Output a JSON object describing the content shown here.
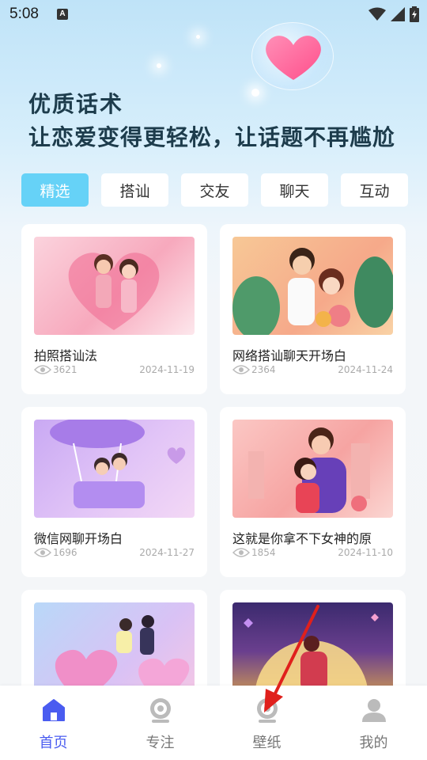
{
  "status": {
    "time": "5:08",
    "a_icon": "A"
  },
  "hero": {
    "line1": "优质话术",
    "line2": "让恋爱变得更轻松，让话题不再尴尬"
  },
  "tabs": [
    {
      "label": "精选",
      "active": true
    },
    {
      "label": "搭讪",
      "active": false
    },
    {
      "label": "交友",
      "active": false
    },
    {
      "label": "聊天",
      "active": false
    },
    {
      "label": "互动",
      "active": false
    }
  ],
  "cards": [
    {
      "title": "拍照搭讪法",
      "views": "3621",
      "date": "2024-11-19"
    },
    {
      "title": "网络搭讪聊天开场白",
      "views": "2364",
      "date": "2024-11-24"
    },
    {
      "title": "微信网聊开场白",
      "views": "1696",
      "date": "2024-11-27"
    },
    {
      "title": "这就是你拿不下女神的原",
      "views": "1854",
      "date": "2024-11-10"
    },
    {
      "title": "",
      "views": "",
      "date": ""
    },
    {
      "title": "",
      "views": "",
      "date": ""
    }
  ],
  "nav": [
    {
      "label": "首页",
      "icon": "home-icon",
      "active": true
    },
    {
      "label": "专注",
      "icon": "focus-icon",
      "active": false
    },
    {
      "label": "壁纸",
      "icon": "wallpaper-icon",
      "active": false
    },
    {
      "label": "我的",
      "icon": "profile-icon",
      "active": false
    }
  ],
  "colors": {
    "accent": "#66d2f7",
    "nav_active": "#4a5cf0",
    "arrow": "#e0201c"
  }
}
